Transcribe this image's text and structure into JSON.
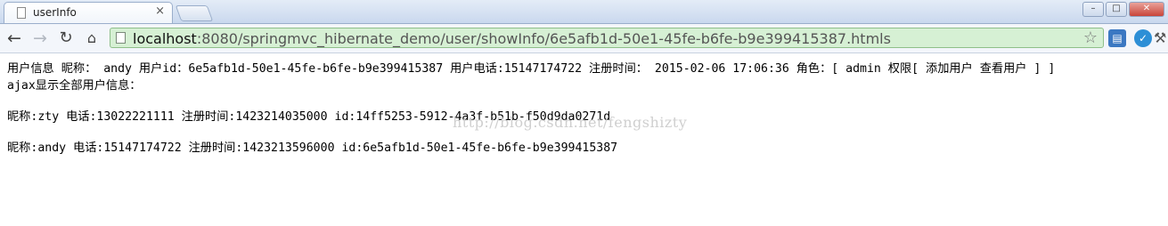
{
  "browser": {
    "tab": {
      "title": "userInfo",
      "close_glyph": "×"
    },
    "window_controls": {
      "minimize": "–",
      "maximize": "□",
      "close": "✕"
    },
    "toolbar": {
      "back_icon": "back-arrow-icon",
      "forward_icon": "forward-arrow-icon",
      "reload_icon": "reload-icon",
      "home_icon": "home-icon",
      "url_host": "localhost",
      "url_rest": ":8080/springmvc_hibernate_demo/user/showInfo/6e5afb1d-50e1-45fe-b6fe-b9e399415387.htmls",
      "bookmark_icon": "star-icon"
    }
  },
  "page": {
    "user_info_line": "用户信息 昵称： andy 用户id：6e5afb1d-50e1-45fe-b6fe-b9e399415387 用户电话:15147174722 注册时间： 2015-02-06 17:06:36 角色：[ admin  权限[ 添加用户 查看用户 ] ]",
    "ajax_heading": "ajax显示全部用户信息：",
    "users": [
      {
        "text": "昵称:zty 电话:13022221111 注册时间:1423214035000 id:14ff5253-5912-4a3f-b51b-f50d9da0271d"
      },
      {
        "text": "昵称:andy 电话:15147174722 注册时间:1423213596000 id:6e5afb1d-50e1-45fe-b6fe-b9e399415387"
      }
    ],
    "watermark": "http://blog.csdn.net/fengshizty"
  },
  "colors": {
    "omnibox_bg": "#d6f0d4",
    "tabstrip_bg": "#c9d8ee",
    "watermark": "#cfcfcf"
  }
}
